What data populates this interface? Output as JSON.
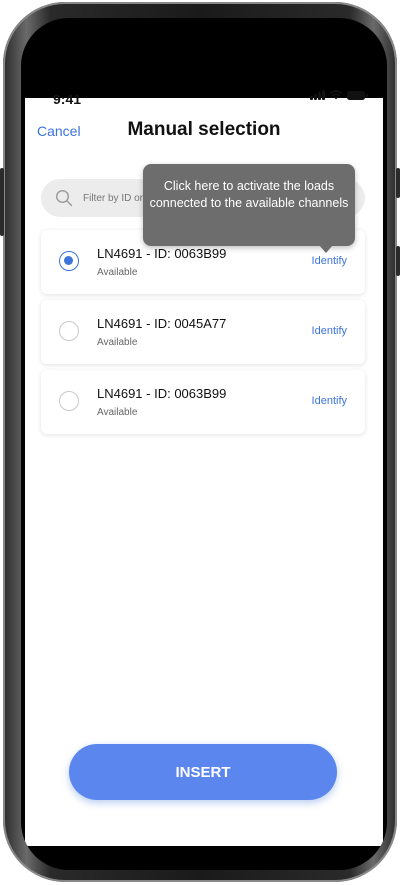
{
  "status_bar": {
    "time": "9:41"
  },
  "header": {
    "cancel_label": "Cancel",
    "title": "Manual selection"
  },
  "search": {
    "placeholder": "Filter by ID or name"
  },
  "tooltip": {
    "text": "Click here to activate the loads connected to the available channels"
  },
  "devices": [
    {
      "title": "LN4691 - ID: 0063B99",
      "status": "Available",
      "action": "Identify",
      "selected": true
    },
    {
      "title": "LN4691 - ID: 0045A77",
      "status": "Available",
      "action": "Identify",
      "selected": false
    },
    {
      "title": "LN4691 - ID: 0063B99",
      "status": "Available",
      "action": "Identify",
      "selected": false
    }
  ],
  "footer": {
    "insert_label": "INSERT"
  },
  "colors": {
    "accent": "#3d74dc",
    "button": "#5b86ee",
    "tooltip": "#6d6d6d"
  }
}
